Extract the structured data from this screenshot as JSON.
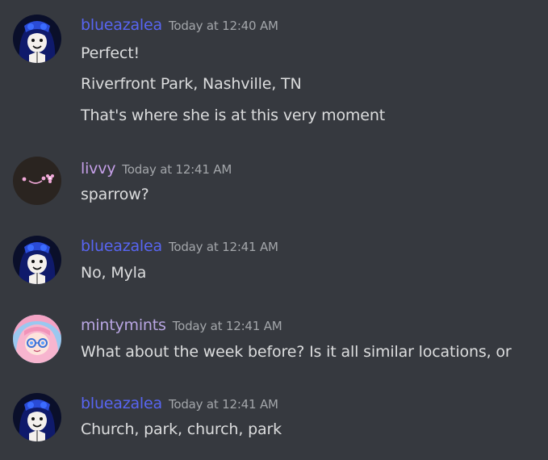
{
  "colors": {
    "background": "#36393f",
    "message_text": "#dcddde",
    "timestamp_text": "#a3a6aa"
  },
  "messages": [
    {
      "username": "blueazalea",
      "username_color": "#5865f2",
      "avatar_icon": "blue-haired-character-avatar-icon",
      "timestamp": "Today at 12:40 AM",
      "lines": [
        "Perfect!",
        "Riverfront Park, Nashville, TN",
        "That's where she is at this very moment"
      ]
    },
    {
      "username": "livvy",
      "username_color": "#c59fe8",
      "avatar_icon": "kaomoji-face-avatar-icon",
      "timestamp": "Today at 12:41 AM",
      "lines": [
        "sparrow?"
      ]
    },
    {
      "username": "blueazalea",
      "username_color": "#5865f2",
      "avatar_icon": "blue-haired-character-avatar-icon",
      "timestamp": "Today at 12:41 AM",
      "lines": [
        "No, Myla"
      ]
    },
    {
      "username": "mintymints",
      "username_color": "#b9a6e3",
      "avatar_icon": "pink-haired-character-avatar-icon",
      "timestamp": "Today at 12:41 AM",
      "lines": [
        "What about the week before? Is it all similar locations, or"
      ]
    },
    {
      "username": "blueazalea",
      "username_color": "#5865f2",
      "avatar_icon": "blue-haired-character-avatar-icon",
      "timestamp": "Today at 12:41 AM",
      "lines": [
        "Church, park, church, park"
      ]
    }
  ]
}
